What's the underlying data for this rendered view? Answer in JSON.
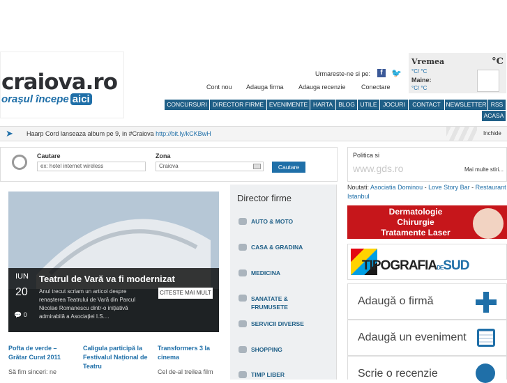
{
  "logo": {
    "main": "craiova.ro",
    "tagline": "orașul începe",
    "aici": "aici"
  },
  "follow_label": "Urmareste-ne si pe:",
  "top_links": [
    "Cont nou",
    "Adauga firma",
    "Adauga recenzie",
    "Conectare"
  ],
  "weather": {
    "title": "Vremea",
    "unit": "°C",
    "today": "°C/ °C",
    "tomorrow_label": "Maine:",
    "tomorrow": "°C/ °C"
  },
  "nav": [
    "CONCURSURI",
    "DIRECTOR FIRME",
    "EVENIMENTE",
    "HARTA",
    "BLOG",
    "UTILE",
    "JOCURI",
    "CONTACT",
    "NEWSLETTER",
    "RSS",
    "ACASA"
  ],
  "ticker": {
    "text": "Haarp Cord lanseaza album pe 9, in #Craiova",
    "link": "http://bit.ly/kCKBwH",
    "close": "Inchide"
  },
  "search": {
    "label_what": "Cautare",
    "placeholder_what": "ex: hotel internet wireless",
    "label_zone": "Zona",
    "zone_value": "Craiova",
    "button": "Cautare"
  },
  "politica": {
    "title": "Politica si",
    "url": "www.gds.ro",
    "more": "Mai multe stiri..."
  },
  "noutati": {
    "label": "Noutati:",
    "items": [
      "Asociatia Dominou",
      "Love Story Bar",
      "Restaurant Istanbul"
    ]
  },
  "featured": {
    "month": "IUN",
    "day": "20",
    "title": "Teatrul de Vară va fi modernizat",
    "excerpt": "Anul trecut scriam un articol despre renașterea Teatrului de Vară din Parcul Nicolae Romanescu dintr-o inițiativă admirabilă a Asociației I.S....",
    "comments": "0",
    "read_more": "CITESTE MAI MULT"
  },
  "director": {
    "title": "Director firme",
    "items": [
      "AUTO & MOTO",
      "CASA & GRADINA",
      "MEDICINA",
      "SANATATE & FRUMUSETE",
      "SERVICII DIVERSE",
      "SHOPPING",
      "TIMP LIBER"
    ]
  },
  "news": [
    {
      "title": "Pofta de verde – Grătar Curat 2011",
      "text": "Să fim sinceri: ne"
    },
    {
      "title": "Caligula participă la Festivalul Național de Teatru",
      "text": ""
    },
    {
      "title": "Transformers 3 la cinema",
      "text": "Cel de-al treilea film"
    }
  ],
  "ads": {
    "derma_lines": [
      "Dermatologie",
      "Chirurgie",
      "Tratamente Laser"
    ],
    "tipografia_main": "TIPOGRAFIA",
    "tipografia_de": "DE",
    "tipografia_sud": "SUD"
  },
  "actions": [
    "Adaugă o firmă",
    "Adaugă un eveniment",
    "Scrie o recenzie"
  ],
  "colors": {
    "brand": "#1f6fa8",
    "nav": "#1f5f87",
    "ad_red": "#c6161b"
  }
}
